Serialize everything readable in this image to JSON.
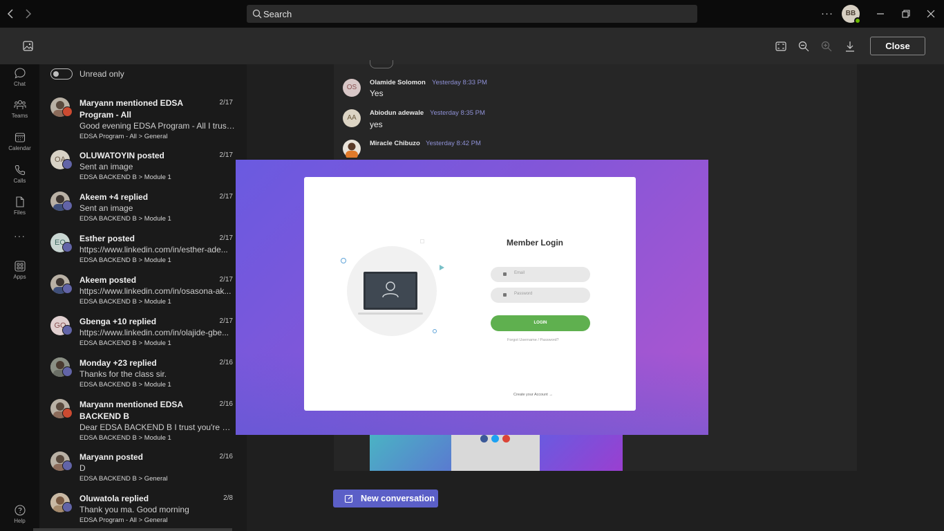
{
  "titlebar": {
    "search_placeholder": "Search",
    "user_initials": "BB",
    "more_label": "···"
  },
  "viewer_toolbar": {
    "close_label": "Close"
  },
  "rail": [
    {
      "label": "Chat",
      "icon": "chat-icon"
    },
    {
      "label": "Teams",
      "icon": "teams-icon"
    },
    {
      "label": "Calendar",
      "icon": "calendar-icon"
    },
    {
      "label": "Calls",
      "icon": "calls-icon"
    },
    {
      "label": "Files",
      "icon": "files-icon"
    },
    {
      "label": "···",
      "icon": "more-icon"
    },
    {
      "label": "Apps",
      "icon": "apps-icon"
    },
    {
      "label": "Help",
      "icon": "help-icon"
    }
  ],
  "feed": {
    "unread_label": "Unread only",
    "items": [
      {
        "title": "Maryann mentioned EDSA Program - All",
        "date": "2/17",
        "preview": "Good evening EDSA Program - All I trust ...",
        "path": "EDSA Program - All > General",
        "initials": "",
        "badge": "mention"
      },
      {
        "title": "OLUWATOYIN posted",
        "date": "2/17",
        "preview": "Sent an image",
        "path": "EDSA BACKEND B > Module 1",
        "initials": "OA",
        "badge": "post"
      },
      {
        "title": "Akeem +4 replied",
        "date": "2/17",
        "preview": "Sent an image",
        "path": "EDSA BACKEND B > Module 1",
        "initials": "",
        "badge": "post"
      },
      {
        "title": "Esther posted",
        "date": "2/17",
        "preview": "https://www.linkedin.com/in/esther-ade...",
        "path": "EDSA BACKEND B > Module 1",
        "initials": "EO",
        "badge": "post"
      },
      {
        "title": "Akeem posted",
        "date": "2/17",
        "preview": "https://www.linkedin.com/in/osasona-ak...",
        "path": "EDSA BACKEND B > Module 1",
        "initials": "",
        "badge": "post"
      },
      {
        "title": "Gbenga +10 replied",
        "date": "2/17",
        "preview": "https://www.linkedin.com/in/olajide-gbe...",
        "path": "EDSA BACKEND B > Module 1",
        "initials": "GO",
        "badge": "post"
      },
      {
        "title": "Monday +23 replied",
        "date": "2/16",
        "preview": "Thanks for the class sir.",
        "path": "EDSA BACKEND B > Module 1",
        "initials": "",
        "badge": "reply"
      },
      {
        "title": "Maryann mentioned EDSA BACKEND B",
        "date": "2/16",
        "preview": "Dear EDSA BACKEND B I trust you're havi...",
        "path": "EDSA BACKEND B > Module 1",
        "initials": "",
        "badge": "mention"
      },
      {
        "title": "Maryann posted",
        "date": "2/16",
        "preview": "D",
        "path": "EDSA BACKEND B > General",
        "initials": "",
        "badge": "post"
      },
      {
        "title": "Oluwatola replied",
        "date": "2/8",
        "preview": "Thank you ma. Good morning",
        "path": "EDSA Program - All > General",
        "initials": "",
        "badge": "reply"
      }
    ]
  },
  "conversation": {
    "messages": [
      {
        "initials": "OS",
        "name": "Olamide Solomon",
        "time": "Yesterday 8:33 PM",
        "text": "Yes"
      },
      {
        "initials": "AA",
        "name": "Abiodun adewale",
        "time": "Yesterday 8:35 PM",
        "text": "yes"
      },
      {
        "initials": "",
        "name": "Miracle Chibuzo",
        "time": "Yesterday 8:42 PM",
        "text": ""
      }
    ],
    "new_conversation_label": "New conversation"
  },
  "image_viewer": {
    "card_title": "Member Login",
    "email_placeholder": "Email",
    "password_placeholder": "Password",
    "login_label": "LOGIN",
    "forgot_text": "Forgot Username / Password?",
    "create_text": "Create your Account →"
  },
  "colors": {
    "accent": "#5b5fc7",
    "badge_post": "#6264a7",
    "badge_mention": "#cc4a31",
    "login_green": "#5fb04f",
    "time_purple": "#8f91d6"
  }
}
